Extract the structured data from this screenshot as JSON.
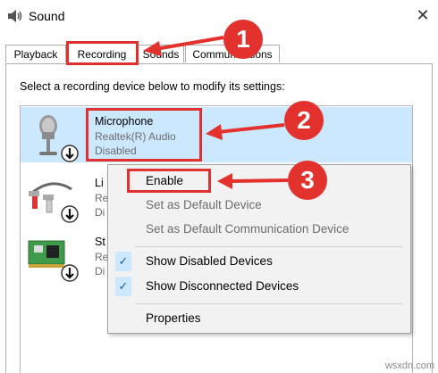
{
  "window": {
    "title": "Sound",
    "close_label": "✕"
  },
  "tabs": [
    {
      "label": "Playback",
      "active": false
    },
    {
      "label": "Recording",
      "active": true
    },
    {
      "label": "Sounds",
      "active": false
    },
    {
      "label": "Communications",
      "active": false
    }
  ],
  "instruction": "Select a recording device below to modify its settings:",
  "devices": [
    {
      "name": "Microphone",
      "line1": "Realtek(R) Audio",
      "line2": "Disabled"
    },
    {
      "name": "Li",
      "line1": "Re",
      "line2": "Di"
    },
    {
      "name": "St",
      "line1": "Re",
      "line2": "Di"
    }
  ],
  "context_menu": {
    "enable": "Enable",
    "set_default": "Set as Default Device",
    "set_default_comm": "Set as Default Communication Device",
    "show_disabled": "Show Disabled Devices",
    "show_disconnected": "Show Disconnected Devices",
    "check_glyph": "✓",
    "properties": "Properties"
  },
  "annotations": {
    "one": "1",
    "two": "2",
    "three": "3",
    "color": "#e3312e"
  },
  "watermark": "wsxdn.com"
}
